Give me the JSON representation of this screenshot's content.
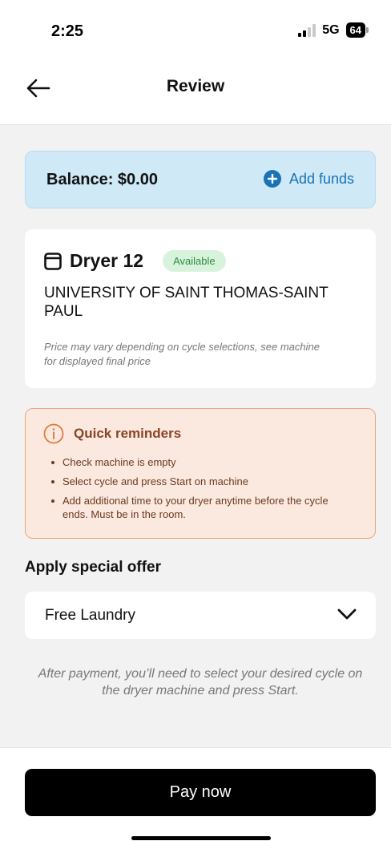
{
  "status_bar": {
    "time": "2:25",
    "network": "5G",
    "battery": "64"
  },
  "header": {
    "title": "Review",
    "back_icon": "arrow-left-icon"
  },
  "balance": {
    "text": "Balance: $0.00",
    "add_funds_label": "Add funds",
    "add_icon": "plus-circle-icon"
  },
  "machine": {
    "icon": "dryer-icon",
    "name": "Dryer 12",
    "status": "Available",
    "location": "UNIVERSITY OF SAINT THOMAS-SAINT PAUL",
    "price_note": "Price may vary depending on cycle selections, see machine for displayed final price"
  },
  "reminders": {
    "icon": "info-icon",
    "title": "Quick reminders",
    "items": [
      "Check machine is empty",
      "Select cycle and press Start on machine",
      "Add additional time to your dryer anytime before the cycle ends. Must be in the room."
    ]
  },
  "offer": {
    "heading": "Apply special offer",
    "selected": "Free Laundry",
    "chevron_icon": "chevron-down-icon"
  },
  "after_payment_note": "After payment, you’ll need to select your desired cycle on the dryer machine and press Start.",
  "pay_button_label": "Pay now",
  "colors": {
    "balance_bg": "#cfe9f7",
    "accent_blue": "#1a73b5",
    "available_bg": "#d8f3dc",
    "available_text": "#2e8b3e",
    "reminder_bg": "#fbe9e0",
    "reminder_border": "#eba57f",
    "reminder_text": "#8a4522",
    "pay_button_bg": "#000000"
  }
}
